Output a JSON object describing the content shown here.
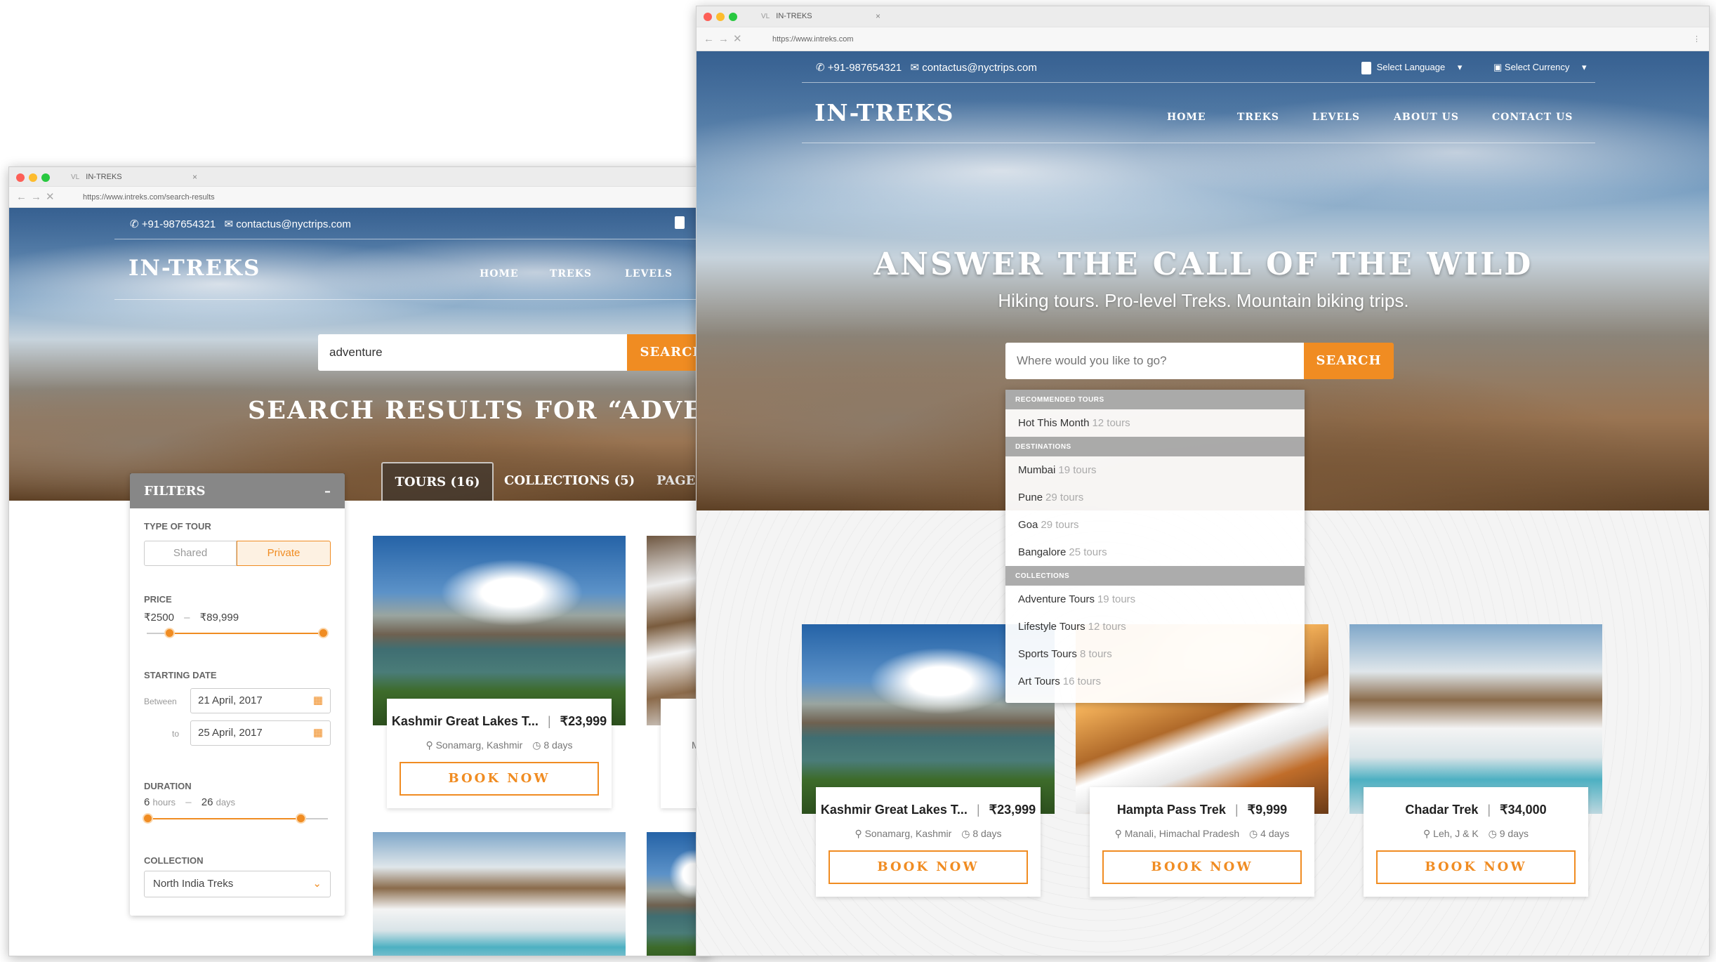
{
  "brand": {
    "logo": "IN-TREKS",
    "accent": "#f08c22"
  },
  "contact": {
    "phone": "+91-987654321",
    "email": "contactus@nyctrips.com"
  },
  "nav": {
    "home": "HOME",
    "treks": "TREKS",
    "levels": "LEVELS",
    "about": "ABOUT US",
    "contact": "CONTACT US"
  },
  "back_window": {
    "tab_title": "IN-TREKS",
    "url": "https://www.intreks.com/search-results",
    "search_value": "adventure",
    "search_button": "SEARCH",
    "results_heading": "SEARCH RESULTS FOR “ADVENT",
    "tabs": [
      "TOURS (16)",
      "COLLECTIONS (5)",
      "PAGES"
    ],
    "filters": {
      "title": "FILTERS",
      "collapse": "–",
      "type_label": "TYPE OF TOUR",
      "type_options": [
        "Shared",
        "Private"
      ],
      "type_selected": "Private",
      "price_label": "PRICE",
      "price_min": "₹2500",
      "price_max": "₹89,999",
      "price_sep": "–",
      "date_label": "STARTING DATE",
      "between": "Between",
      "to": "to",
      "date_from": "21 April, 2017",
      "date_to": "25 April, 2017",
      "duration_label": "DURATION",
      "duration_min_num": "6",
      "duration_min_unit": "hours",
      "duration_max_num": "26",
      "duration_max_unit": "days",
      "collection_label": "COLLECTION",
      "collection_value": "North India Treks"
    },
    "cards": [
      {
        "title": "Kashmir Great Lakes T...",
        "price": "₹23,999",
        "location": "Sonamarg, Kashmir",
        "duration": "8 days",
        "cta": "BOOK NOW"
      },
      {
        "title": "H",
        "location": "M"
      }
    ]
  },
  "front_window": {
    "tab_title": "IN-TREKS",
    "url": "https://www.intreks.com",
    "select_language": "Select Language",
    "select_currency": "Select Currency",
    "hero_title": "ANSWER THE CALL OF THE WILD",
    "hero_subtitle": "Hiking tours. Pro-level Treks. Mountain biking trips.",
    "search_placeholder": "Where would you like to go?",
    "search_button": "SEARCH",
    "dropdown": {
      "sections": [
        {
          "header": "RECOMMENDED TOURS",
          "items": [
            {
              "name": "Hot This Month",
              "count": "12 tours"
            }
          ]
        },
        {
          "header": "DESTINATIONS",
          "items": [
            {
              "name": "Mumbai",
              "count": "19 tours"
            },
            {
              "name": "Pune",
              "count": "29 tours"
            },
            {
              "name": "Goa",
              "count": "29 tours"
            },
            {
              "name": "Bangalore",
              "count": "25 tours"
            }
          ]
        },
        {
          "header": "COLLECTIONS",
          "items": [
            {
              "name": "Adventure Tours",
              "count": "19 tours"
            },
            {
              "name": "Lifestyle Tours",
              "count": "12 tours"
            },
            {
              "name": "Sports Tours",
              "count": "8 tours"
            },
            {
              "name": "Art Tours",
              "count": "16 tours"
            }
          ]
        }
      ]
    },
    "cards": [
      {
        "title": "Kashmir Great Lakes T...",
        "price": "₹23,999",
        "location": "Sonamarg, Kashmir",
        "duration": "8 days",
        "cta": "BOOK NOW"
      },
      {
        "title": "Hampta Pass Trek",
        "price": "₹9,999",
        "location": "Manali, Himachal Pradesh",
        "duration": "4 days",
        "cta": "BOOK NOW"
      },
      {
        "title": "Chadar Trek",
        "price": "₹34,000",
        "location": "Leh, J & K",
        "duration": "9 days",
        "cta": "BOOK NOW"
      }
    ]
  }
}
